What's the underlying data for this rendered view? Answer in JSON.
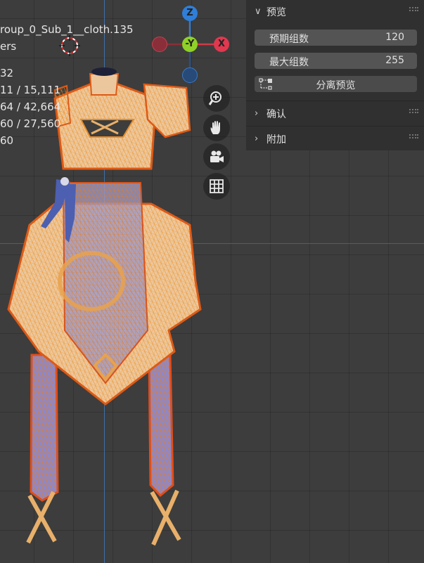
{
  "viewport": {
    "stats": [
      "roup_0_Sub_1__cloth.135",
      "ers",
      "32",
      "11 / 15,111",
      "64 / 42,664",
      "60 / 27,560",
      "60"
    ],
    "gizmo": {
      "z": "Z",
      "neg_y": "-Y",
      "x": "X"
    },
    "colors": {
      "x_axis": "#a03c45",
      "y_axis": "#3f6fa8",
      "mesh_wire": "#e8751c",
      "mesh_select": "#f7a21b"
    }
  },
  "panel": {
    "preview": {
      "title": "预览",
      "expected_groups_label": "预期组数",
      "expected_groups_value": "120",
      "max_groups_label": "最大组数",
      "max_groups_value": "255",
      "split_preview_label": "分离预览"
    },
    "confirm": {
      "title": "确认"
    },
    "extra": {
      "title": "附加"
    }
  }
}
